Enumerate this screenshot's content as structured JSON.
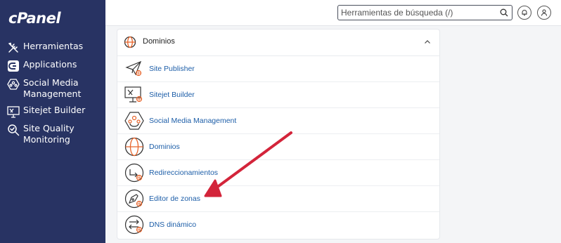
{
  "brand": {
    "logo_text": "cPanel"
  },
  "sidebar": {
    "items": [
      {
        "label": "Herramientas",
        "icon": "tools-icon"
      },
      {
        "label": "Applications",
        "icon": "applications-icon"
      },
      {
        "label": "Social Media Management",
        "icon": "social-media-icon"
      },
      {
        "label": "Sitejet Builder",
        "icon": "sitejet-icon"
      },
      {
        "label": "Site Quality Monitoring",
        "icon": "site-quality-icon"
      }
    ]
  },
  "header": {
    "search": {
      "placeholder": "Herramientas de búsqueda (/)",
      "value": ""
    },
    "buttons": [
      "notifications-icon",
      "user-icon"
    ]
  },
  "panel": {
    "title": "Dominios",
    "items": [
      {
        "label": "Site Publisher",
        "icon": "site-publisher-icon"
      },
      {
        "label": "Sitejet Builder",
        "icon": "sitejet-builder-icon"
      },
      {
        "label": "Social Media Management",
        "icon": "social-media-management-icon"
      },
      {
        "label": "Dominios",
        "icon": "domains-icon"
      },
      {
        "label": "Redireccionamientos",
        "icon": "redirects-icon"
      },
      {
        "label": "Editor de zonas",
        "icon": "zone-editor-icon"
      },
      {
        "label": "DNS dinámico",
        "icon": "dynamic-dns-icon"
      }
    ]
  },
  "colors": {
    "sidebar_bg": "#283363",
    "link": "#1d5ea8",
    "accent_orange": "#e8652b",
    "annotation_arrow": "#d3243a"
  }
}
